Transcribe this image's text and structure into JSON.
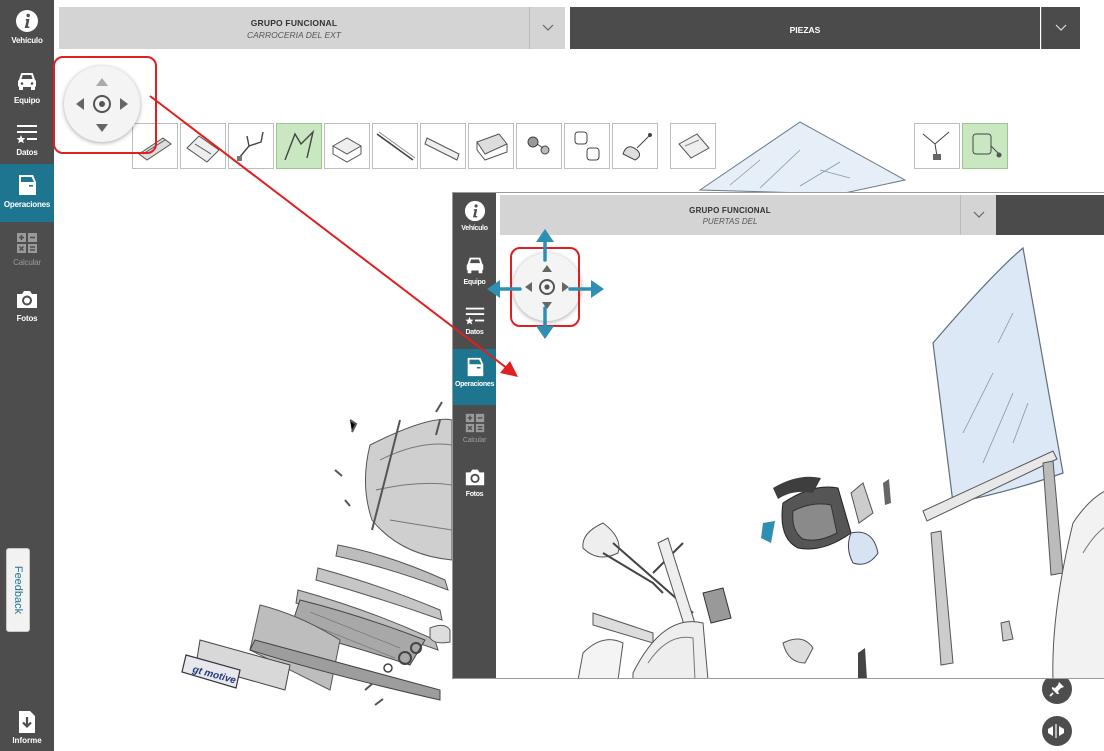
{
  "main": {
    "sidebar": {
      "items": [
        {
          "label": "Vehículo",
          "icon": "info-icon"
        },
        {
          "label": "Equipo",
          "icon": "car-icon"
        },
        {
          "label": "Datos",
          "icon": "data-list-icon"
        },
        {
          "label": "Operaciones",
          "icon": "car-door-icon"
        },
        {
          "label": "Calcular",
          "icon": "calculator-icon"
        },
        {
          "label": "Fotos",
          "icon": "camera-icon"
        }
      ],
      "report_label": "Informe",
      "active": "Operaciones"
    },
    "header": {
      "group_title": "GRUPO FUNCIONAL",
      "group_subtitle": "CARROCERIA DEL EXT",
      "parts_label": "PIEZAS"
    },
    "feedback_label": "Feedback",
    "diagram_logo": "gt motive"
  },
  "overlay": {
    "sidebar": {
      "items": [
        {
          "label": "Vehículo",
          "icon": "info-icon"
        },
        {
          "label": "Equipo",
          "icon": "car-icon"
        },
        {
          "label": "Datos",
          "icon": "data-list-icon"
        },
        {
          "label": "Operaciones",
          "icon": "car-door-icon"
        },
        {
          "label": "Calcular",
          "icon": "calculator-icon"
        },
        {
          "label": "Fotos",
          "icon": "camera-icon"
        }
      ]
    },
    "header": {
      "group_title": "GRUPO FUNCIONAL",
      "group_subtitle": "PUERTAS DEL"
    }
  },
  "colors": {
    "sidebar_bg": "#4d4d4d",
    "active_bg": "#1e7590",
    "header_light": "#d4d4d4",
    "header_dark": "#4b4b4b",
    "highlight": "#e02020",
    "arrow_blue": "#2e8fb3",
    "selected_thumb": "#c9e7c0"
  }
}
